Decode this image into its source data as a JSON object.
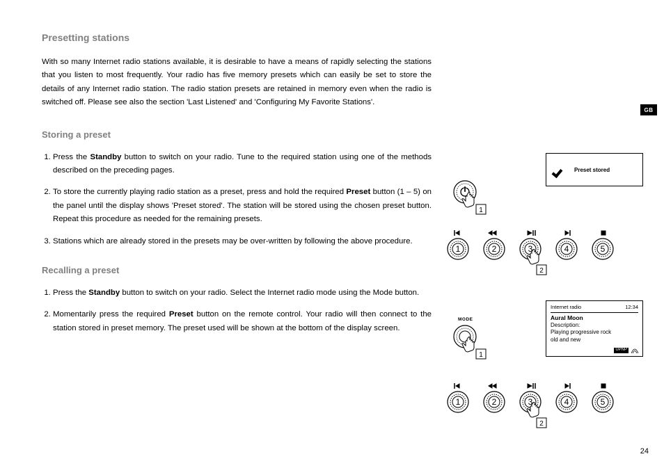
{
  "tab_label": "GB",
  "page_number": "24",
  "section_title": "Presetting stations",
  "intro_text": "With so many Internet radio stations available, it is desirable to have a means of rapidly selecting the stations that you listen to most frequently. Your radio has five memory presets which can easily be set to store the details of any Internet radio station. The radio station presets are retained in memory even when the radio is switched off. Please see also the section 'Last Listened' and 'Configuring My Favorite Stations'.",
  "storing_title": "Storing a preset",
  "storing_steps": {
    "s1a": "Press the ",
    "s1b": "Standby",
    "s1c": " button to switch on your radio. Tune to the required station using one of the methods described on the preceding pages.",
    "s2a": "To store the currently playing radio station as a preset, press and hold the required ",
    "s2b": "Preset",
    "s2c": " button (1 – 5) on the panel until the display shows 'Preset stored'. The station will be stored using the chosen preset button. Repeat this procedure as needed for the remaining presets.",
    "s3": "Stations which are already stored in the presets may be over-written by following the above procedure."
  },
  "recalling_title": "Recalling a preset",
  "recalling_steps": {
    "r1a": "Press the ",
    "r1b": "Standby",
    "r1c": " button to switch on your radio. Select the Internet radio mode using the Mode button.",
    "r2a": "Momentarily press the required ",
    "r2b": "Preset",
    "r2c": " button on the remote control. Your radio will then connect to the station stored in preset memory. The preset used will be shown at the bottom of the display screen."
  },
  "screen1": {
    "preset_stored": "Preset stored"
  },
  "screen2": {
    "header_left": "Internet radio",
    "header_right": "12:34",
    "station": "Aural Moon",
    "desc_label": "Description:",
    "desc_line1": "Playing progressive rock",
    "desc_line2": "old and new",
    "badge": "UPNP"
  },
  "mode_label": "MODE",
  "knob_numbers": [
    "1",
    "2",
    "3",
    "4",
    "5"
  ],
  "callout_1": "1",
  "callout_2": "2"
}
